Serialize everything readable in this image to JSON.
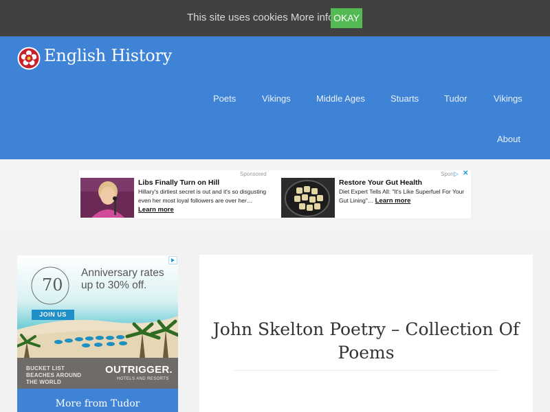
{
  "cookie_bar": {
    "message": "This site uses cookies More info",
    "okay_label": "OKAY"
  },
  "header": {
    "site_title": "English History",
    "nav": [
      "Poets",
      "Vikings",
      "Middle Ages",
      "Stuarts",
      "Tudor",
      "Vikings",
      "About"
    ]
  },
  "top_ad": {
    "left": {
      "headline": "Libs Finally Turn on Hill",
      "body": "Hillary's dirtiest secret is out and it's so disgusting even her most loyal followers are over her…",
      "link": "Learn more",
      "sponsored": "Sponsored"
    },
    "right": {
      "headline": "Restore Your Gut Health",
      "body": "Diet Expert Tells All: \"It's Like Superfuel For Your Gut Lining\"…",
      "link": "Learn more",
      "sponsored": "Spon"
    }
  },
  "side_ad": {
    "headline": "Anniversary rates up to 30% off.",
    "badge_year": "70",
    "join_label": "JOIN US",
    "footer_left": "BUCKET LIST BEACHES AROUND THE WORLD",
    "brand": "OUTRIGGER.",
    "brand_sub": "HOTELS AND RESORTS"
  },
  "sidebar": {
    "more_title": "More from Tudor"
  },
  "article": {
    "title": "John Skelton Poetry – Collection Of Poems"
  },
  "colors": {
    "header_blue": "#3f83d6",
    "cookie_bar": "#414141",
    "okay_green": "#52b953"
  }
}
